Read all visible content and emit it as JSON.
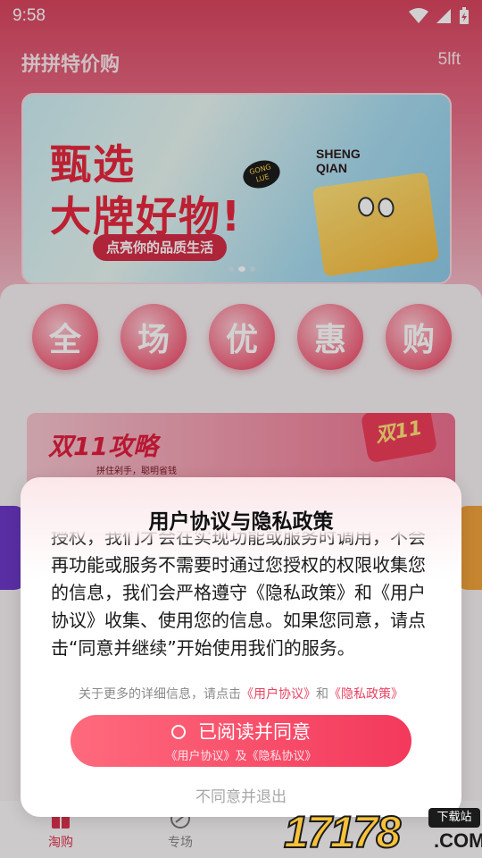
{
  "status": {
    "time": "9:58"
  },
  "header": {
    "title": "拼拼特价购",
    "right": "5lft"
  },
  "banner": {
    "line1": "甄选",
    "line2": "大牌好物!",
    "pill": "点亮你的品质生活",
    "tag": "GONG LUE",
    "sheng": "SHENG",
    "qian": "QIAN"
  },
  "categories": [
    "全",
    "场",
    "优",
    "惠",
    "购"
  ],
  "promo": {
    "title": "双11攻略",
    "subtitle": "拼住剁手，聪明省钱",
    "card": "双11"
  },
  "tabbar": {
    "items": [
      {
        "label": "淘购"
      },
      {
        "label": "专场"
      }
    ]
  },
  "dialog": {
    "title": "用户协议与隐私政策",
    "body": "授权，我们才会在实现功能或服务时调用，不会再功能或服务不需要时通过您授权的权限收集您的信息，我们会严格遵守《隐私政策》和《用户协议》收集、使用您的信息。如果您同意，请点击“同意并继续”开始使用我们的服务。",
    "more_prefix": "关于更多的详细信息，请点击",
    "more_link1": "《用户协议》",
    "more_and": "和",
    "more_link2": "《隐私政策》",
    "agree_label": "已阅读并同意",
    "agree_sub": "《用户协议》及《隐私协议》",
    "reject_label": "不同意并退出"
  },
  "watermark": {
    "number": "17178",
    "domain": ".COM",
    "download": "下载站"
  },
  "colors": {
    "accent": "#f3395c",
    "brand_red": "#e6283d",
    "link": "#e84362"
  }
}
